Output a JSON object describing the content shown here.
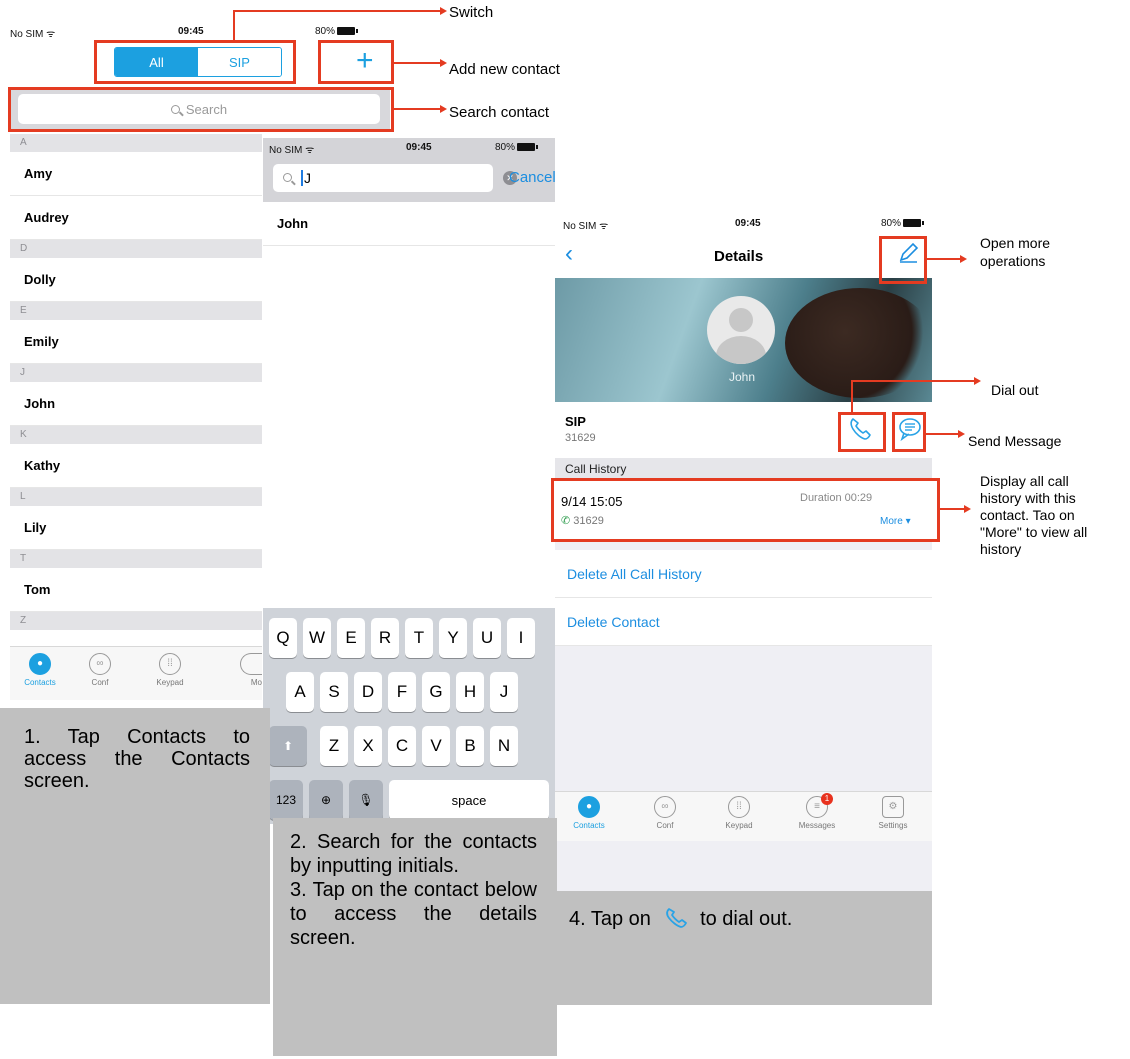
{
  "screen1": {
    "status": {
      "carrier": "No SIM",
      "time": "09:45",
      "battery": "80%"
    },
    "switch": {
      "all": "All",
      "sip": "SIP"
    },
    "add_symbol": "+",
    "search_placeholder": "Search",
    "sections": [
      {
        "letter": "A",
        "contacts": [
          "Amy",
          "Audrey"
        ]
      },
      {
        "letter": "D",
        "contacts": [
          "Dolly"
        ]
      },
      {
        "letter": "E",
        "contacts": [
          "Emily"
        ]
      },
      {
        "letter": "J",
        "contacts": [
          "John"
        ]
      },
      {
        "letter": "K",
        "contacts": [
          "Kathy"
        ]
      },
      {
        "letter": "L",
        "contacts": [
          "Lily"
        ]
      },
      {
        "letter": "T",
        "contacts": [
          "Tom"
        ]
      },
      {
        "letter": "Z",
        "contacts": []
      }
    ],
    "tabs": [
      "Contacts",
      "Conf",
      "Keypad",
      "Mo"
    ]
  },
  "screen2": {
    "status": {
      "carrier": "No SIM",
      "time": "09:45",
      "battery": "80%"
    },
    "search_value": "J",
    "cancel": "Cancel",
    "result": "John",
    "keyboard": {
      "row1": [
        "Q",
        "W",
        "E",
        "R",
        "T",
        "Y",
        "U",
        "I"
      ],
      "row2": [
        "A",
        "S",
        "D",
        "F",
        "G",
        "H",
        "J"
      ],
      "row3": [
        "Z",
        "X",
        "C",
        "V",
        "B",
        "N"
      ],
      "num": "123",
      "space": "space"
    }
  },
  "screen3": {
    "status": {
      "carrier": "No SIM",
      "time": "09:45",
      "battery": "80%"
    },
    "title": "Details",
    "contact_name": "John",
    "account_type": "SIP",
    "number": "31629",
    "call_history_label": "Call History",
    "history": {
      "datetime": "9/14 15:05",
      "duration": "Duration 00:29",
      "number": "31629",
      "more": "More"
    },
    "delete_history": "Delete All Call History",
    "delete_contact": "Delete Contact",
    "tabs": [
      "Contacts",
      "Conf",
      "Keypad",
      "Messages",
      "Settings"
    ],
    "messages_badge": "1"
  },
  "annotations": {
    "switch": "Switch",
    "add": "Add new contact",
    "search": "Search contact",
    "more_ops": [
      "Open more",
      "operations"
    ],
    "dial": "Dial out",
    "send": "Send Message",
    "history": [
      "Display all call",
      "history with this",
      "contact. Tao on",
      "\"More\" to view all",
      "history"
    ]
  },
  "notes": {
    "n1": "1. Tap Contacts to access the Contacts screen.",
    "n2": "2. Search for the contacts by inputting initials.",
    "n3": "3. Tap on the contact below to access the details screen.",
    "n4_pre": "4. Tap on",
    "n4_post": "to dial out."
  },
  "colors": {
    "accent": "#1ca0e0",
    "annotation": "#e43b21",
    "note_bg": "#c0c0c0"
  }
}
